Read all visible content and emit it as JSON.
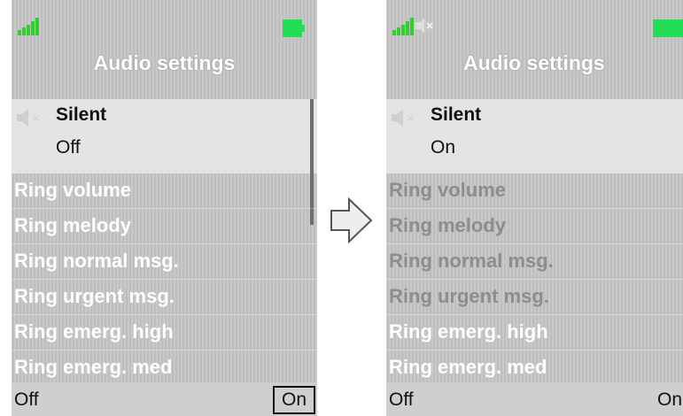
{
  "before": {
    "title": "Audio settings",
    "selected_item": {
      "title": "Silent",
      "value": "Off"
    },
    "menu_items": [
      "Ring volume",
      "Ring melody",
      "Ring normal msg.",
      "Ring urgent msg.",
      "Ring emerg. high",
      "Ring emerg. med"
    ],
    "softkeys": {
      "left": "Off",
      "right": "On"
    }
  },
  "after": {
    "title": "Audio settings",
    "selected_item": {
      "title": "Silent",
      "value": "On"
    },
    "menu_items": [
      "Ring volume",
      "Ring melody",
      "Ring normal msg.",
      "Ring urgent msg.",
      "Ring emerg. high",
      "Ring emerg. med"
    ],
    "softkeys": {
      "left": "Off",
      "right": "On"
    }
  },
  "icons": {
    "signal": "signal-strength-icon",
    "battery": "battery-icon",
    "mute": "speaker-muted-icon",
    "arrow": "right-arrow-icon"
  },
  "colors": {
    "signal": "#33cc33",
    "battery": "#22dd55",
    "screen_background": "#c4c4c4",
    "selected_background": "#e4e4e4",
    "disabled_text": "#8d8d8d"
  }
}
